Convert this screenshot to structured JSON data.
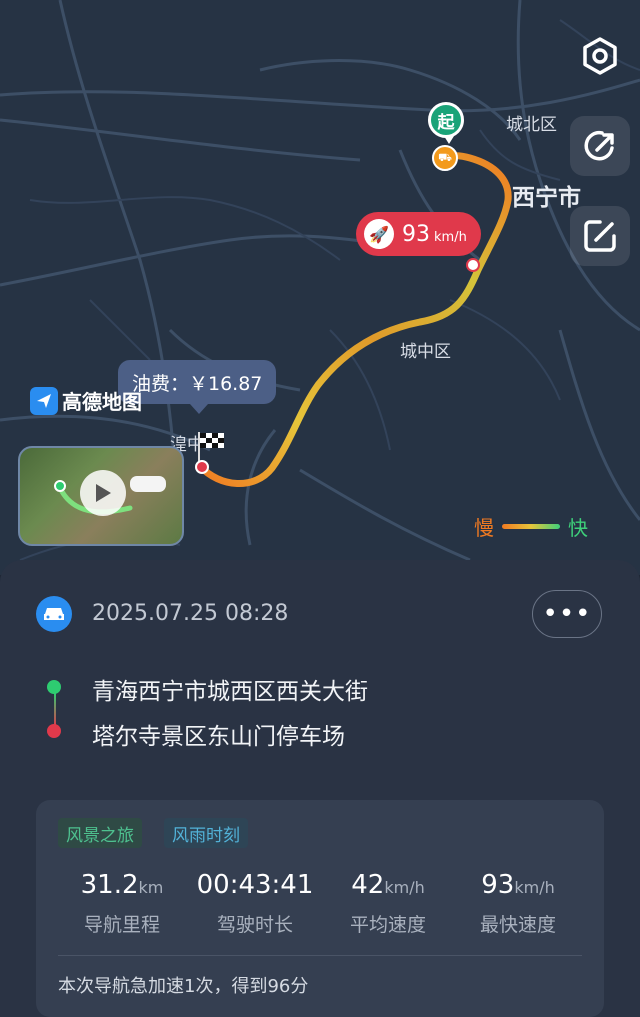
{
  "map": {
    "labels": {
      "district_north": "城北区",
      "city": "西宁市",
      "district_center": "城中区",
      "town": "湟中"
    },
    "start_marker": "起",
    "max_speed_bubble": {
      "value": "93",
      "unit": "km/h"
    },
    "fuel_bubble": "油费：￥16.87",
    "logo": "高德地图",
    "legend": {
      "slow": "慢",
      "fast": "快"
    },
    "buttons": [
      "settings-icon",
      "share-icon",
      "edit-icon"
    ],
    "route_colors": {
      "slow": "#f07a22",
      "mid": "#e6c53a",
      "fast": "#3ecf7a"
    }
  },
  "trip": {
    "datetime": "2025.07.25 08:28",
    "more_label": "•••",
    "start_address": "青海西宁市城西区西关大街",
    "end_address": "塔尔寺景区东山门停车场",
    "tags": [
      "风景之旅",
      "风雨时刻"
    ],
    "stats": [
      {
        "value": "31.2",
        "unit": "km",
        "label": "导航里程"
      },
      {
        "value": "00:43:41",
        "unit": "",
        "label": "驾驶时长"
      },
      {
        "value": "42",
        "unit": "km/h",
        "label": "平均速度"
      },
      {
        "value": "93",
        "unit": "km/h",
        "label": "最快速度"
      }
    ],
    "note": "本次导航急加速1次，得到96分"
  }
}
